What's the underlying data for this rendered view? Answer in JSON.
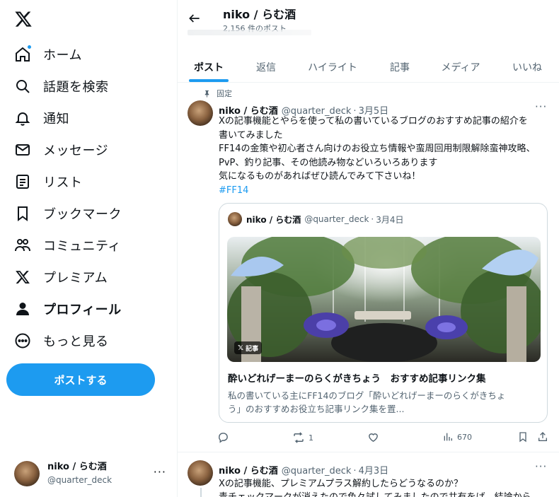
{
  "nav": {
    "items": [
      {
        "label": "ホーム",
        "icon": "home-icon"
      },
      {
        "label": "話題を検索",
        "icon": "search-icon"
      },
      {
        "label": "通知",
        "icon": "bell-icon"
      },
      {
        "label": "メッセージ",
        "icon": "mail-icon"
      },
      {
        "label": "リスト",
        "icon": "list-icon"
      },
      {
        "label": "ブックマーク",
        "icon": "bookmark-icon"
      },
      {
        "label": "コミュニティ",
        "icon": "people-icon"
      },
      {
        "label": "プレミアム",
        "icon": "x-logo-icon"
      },
      {
        "label": "プロフィール",
        "icon": "person-icon"
      },
      {
        "label": "もっと見る",
        "icon": "more-circle-icon"
      }
    ],
    "post_button": "ポストする"
  },
  "account": {
    "name": "niko / らむ酒",
    "handle": "@quarter_deck",
    "more": "···"
  },
  "header": {
    "name": "niko / らむ酒",
    "post_count": "2,156 件のポスト"
  },
  "tabs": [
    "ポスト",
    "返信",
    "ハイライト",
    "記事",
    "メディア",
    "いいね"
  ],
  "pinned_tweet": {
    "pinned_label": "固定",
    "name": "niko / らむ酒",
    "handle": "@quarter_deck",
    "sep": "·",
    "date": "3月5日",
    "more": "···",
    "lines": [
      "Xの記事機能とやらを使って私の書いているブログのおすすめ記事の紹介を",
      "書いてみました",
      "FF14の金策や初心者さん向けのお役立ち情報や蛮周回用制限解除蛮神攻略、",
      "PvP、釣り記事、その他読み物などいろいろあります",
      "気になるものがあればぜひ読んでみて下さいね！"
    ],
    "hashtag": "#FF14",
    "quote": {
      "name": "niko / らむ酒",
      "handle": "@quarter_deck",
      "sep": "·",
      "date": "3月4日",
      "badge": "記事",
      "title": "酔いどれげーまーのらくがきちょう　おすすめ記事リンク集",
      "desc_lines": [
        "私の書いている主にFF14のブログ「酔いどれげーまーのらくがきちょ",
        "う」のおすすめお役立ち記事リンク集を置..."
      ]
    },
    "actions": {
      "replies": "",
      "reposts": "1",
      "likes": "",
      "views": "670"
    }
  },
  "second_tweet": {
    "name": "niko / らむ酒",
    "handle": "@quarter_deck",
    "sep": "·",
    "date": "4月3日",
    "more": "···",
    "lines": [
      "Xの記事機能、プレミアムプラス解約したらどうなるのか？",
      "青チェックマークが消えたので色々試してみましたので共有をば。結論から"
    ]
  },
  "colors": {
    "accent": "#1d9bf0",
    "text": "#0f1419",
    "muted": "#536471",
    "border": "#eff3f4"
  }
}
